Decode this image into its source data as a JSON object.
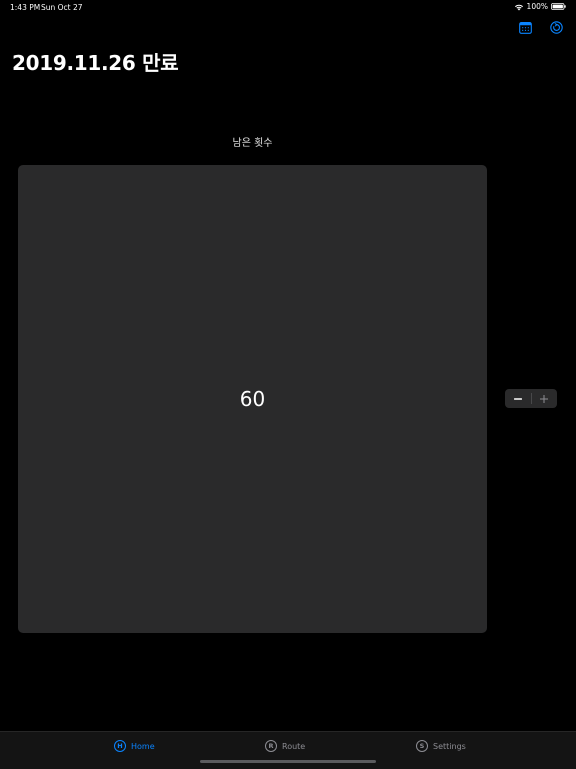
{
  "status_bar": {
    "time": "1:43 PM",
    "date": "Sun Oct 27",
    "battery": "100%"
  },
  "nav": {
    "calendar_icon": "calendar-icon",
    "refresh_icon": "refresh-icon",
    "accent_color": "#0a84ff"
  },
  "header": {
    "title": "2019.11.26 만료"
  },
  "main": {
    "section_label": "남은 횟수",
    "counter_value": "60"
  },
  "stepper": {
    "minus": "−",
    "plus": "+"
  },
  "tab_bar": {
    "tabs": [
      {
        "badge": "H",
        "label": "Home",
        "selected": true
      },
      {
        "badge": "R",
        "label": "Route",
        "selected": false
      },
      {
        "badge": "S",
        "label": "Settings",
        "selected": false
      }
    ]
  }
}
